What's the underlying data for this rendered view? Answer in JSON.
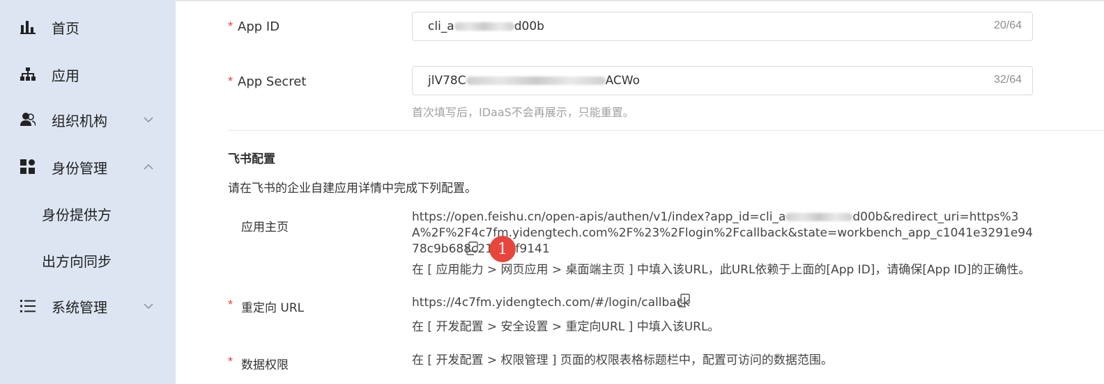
{
  "sidebar": {
    "items": [
      {
        "label": "首页",
        "icon": "bar-chart-icon"
      },
      {
        "label": "应用",
        "icon": "sitemap-icon"
      },
      {
        "label": "组织机构",
        "icon": "users-icon",
        "chevron": "down"
      },
      {
        "label": "身份管理",
        "icon": "grid-icon",
        "chevron": "up"
      },
      {
        "label": "身份提供方"
      },
      {
        "label": "出方向同步"
      },
      {
        "label": "系统管理",
        "icon": "list-icon",
        "chevron": "down"
      }
    ]
  },
  "form": {
    "app_id": {
      "label": "App ID",
      "value_prefix": "cli_a",
      "value_suffix": "d00b",
      "count": "20/64"
    },
    "app_secret": {
      "label": "App Secret",
      "value_prefix": "jlV78C",
      "value_suffix": "ACWo",
      "count": "32/64",
      "hint": "首次填写后，IDaaS不会再展示，只能重置。"
    }
  },
  "feishu": {
    "title": "飞书配置",
    "desc": "请在飞书的企业自建应用详情中完成下列配置。",
    "homepage": {
      "label": "应用主页",
      "url_part1": "https://open.feishu.cn/open-apis/authen/v1/index?app_id=cli_a",
      "url_part2": "d00b&redirect_uri=https%3A%2F%2F4c7fm.yidengtech.com%2F%23%2Flogin%2Fcallback&state=workbench_app_c1041e3291e9478c9b688c215d8f9141",
      "note": "在 [ 应用能力 > 网页应用 > 桌面端主页 ] 中填入该URL，此URL依赖于上面的[App ID]，请确保[App ID]的正确性。"
    },
    "redirect": {
      "label": "重定向 URL",
      "url": "https://4c7fm.yidengtech.com/#/login/callback",
      "note": "在 [ 开发配置 > 安全设置 > 重定向URL ] 中填入该URL。"
    },
    "permission": {
      "label": "数据权限",
      "note": "在 [ 开发配置 > 权限管理 ] 页面的权限表格标题栏中，配置可访问的数据范围。"
    }
  },
  "required_mark": "*",
  "step_badge": "1",
  "colors": {
    "sidebar_bg": "#dde5f2",
    "required": "#e8453c",
    "badge": "#e8453c"
  }
}
